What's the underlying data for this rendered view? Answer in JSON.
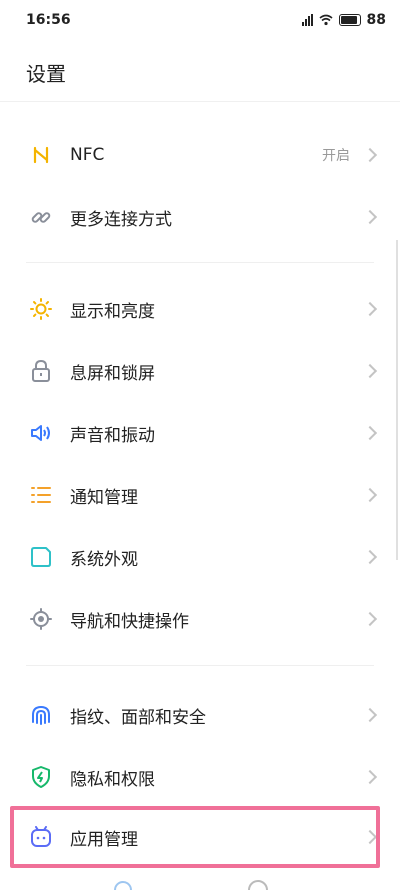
{
  "status": {
    "time": "16:56",
    "battery": "88"
  },
  "header": {
    "title": "设置"
  },
  "sections": [
    {
      "items": [
        {
          "label": "NFC",
          "value": "开启",
          "icon": "nfc-icon",
          "color": "#f4b400"
        },
        {
          "label": "更多连接方式",
          "value": "",
          "icon": "link-icon",
          "color": "#8a8f9a"
        }
      ]
    },
    {
      "items": [
        {
          "label": "显示和亮度",
          "icon": "brightness-icon",
          "color": "#f4b400"
        },
        {
          "label": "息屏和锁屏",
          "icon": "lock-icon",
          "color": "#8a8f9a"
        },
        {
          "label": "声音和振动",
          "icon": "sound-icon",
          "color": "#3a7afe"
        },
        {
          "label": "通知管理",
          "icon": "notification-list-icon",
          "color": "#f4a12a"
        },
        {
          "label": "系统外观",
          "icon": "appearance-icon",
          "color": "#2ec1c8"
        },
        {
          "label": "导航和快捷操作",
          "icon": "navigation-icon",
          "color": "#8a8f9a"
        }
      ]
    },
    {
      "items": [
        {
          "label": "指纹、面部和安全",
          "icon": "fingerprint-icon",
          "color": "#3a7afe"
        },
        {
          "label": "隐私和权限",
          "icon": "shield-icon",
          "color": "#17b86b"
        },
        {
          "label": "应用管理",
          "icon": "app-manage-icon",
          "color": "#5b6cf6"
        }
      ]
    }
  ]
}
